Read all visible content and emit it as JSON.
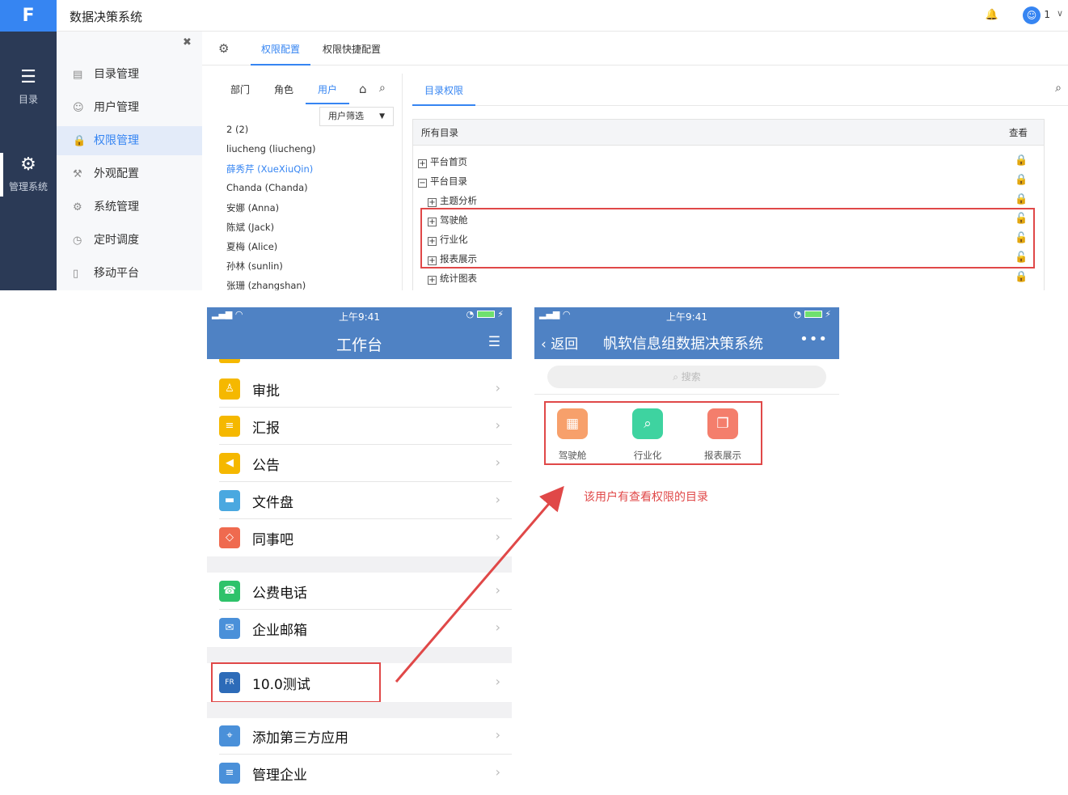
{
  "desktop": {
    "app_title": "数据决策系统",
    "user": {
      "name": "1"
    },
    "left_nav": [
      {
        "label": "目录"
      },
      {
        "label": "管理系统"
      }
    ],
    "sidebar": [
      {
        "label": "目录管理"
      },
      {
        "label": "用户管理"
      },
      {
        "label": "权限管理"
      },
      {
        "label": "外观配置"
      },
      {
        "label": "系统管理"
      },
      {
        "label": "定时调度"
      },
      {
        "label": "移动平台"
      }
    ],
    "tabs": [
      {
        "label": "权限配置"
      },
      {
        "label": "权限快捷配置"
      }
    ],
    "user_tabs": [
      {
        "label": "部门"
      },
      {
        "label": "角色"
      },
      {
        "label": "用户"
      }
    ],
    "filter_label": "用户筛选",
    "users": [
      "2 (2)",
      "liucheng (liucheng)",
      "薛秀芹 (XueXiuQin)",
      "Chanda (Chanda)",
      "安娜 (Anna)",
      "陈斌 (Jack)",
      "夏梅 (Alice)",
      "孙林 (sunlin)",
      "张珊 (zhangshan)"
    ],
    "right_tab": "目录权限",
    "tree_header": {
      "all": "所有目录",
      "view": "查看"
    },
    "tree": [
      {
        "label": "平台首页",
        "sign": "+",
        "lock": "locked"
      },
      {
        "label": "平台目录",
        "sign": "−",
        "lock": "locked"
      },
      {
        "label": "主题分析",
        "sign": "+",
        "lock": "locked"
      },
      {
        "label": "驾驶舱",
        "sign": "+",
        "lock": "unlocked"
      },
      {
        "label": "行业化",
        "sign": "+",
        "lock": "unlocked"
      },
      {
        "label": "报表展示",
        "sign": "+",
        "lock": "unlocked"
      },
      {
        "label": "统计图表",
        "sign": "+",
        "lock": "locked"
      }
    ]
  },
  "phone_left": {
    "time": "上午9:41",
    "title": "工作台",
    "group1": [
      {
        "label": "审批",
        "color": "#f5b800",
        "icon": "stamp-icon"
      },
      {
        "label": "汇报",
        "color": "#f5b800",
        "icon": "report-icon"
      },
      {
        "label": "公告",
        "color": "#f5b800",
        "icon": "megaphone-icon"
      },
      {
        "label": "文件盘",
        "color": "#4aa8e0",
        "icon": "disk-icon"
      },
      {
        "label": "同事吧",
        "color": "#ef6a4f",
        "icon": "colleague-icon"
      }
    ],
    "group2": [
      {
        "label": "公费电话",
        "color": "#2ec26a",
        "icon": "phone-icon"
      },
      {
        "label": "企业邮箱",
        "color": "#4a90d9",
        "icon": "mail-icon"
      }
    ],
    "group3": [
      {
        "label": "10.0测试",
        "color": "#2d6bb8",
        "icon": "fanruan-logo-icon"
      }
    ],
    "group4": [
      {
        "label": "添加第三方应用",
        "color": "#4a90d9",
        "icon": "compass-icon"
      },
      {
        "label": "管理企业",
        "color": "#4a90d9",
        "icon": "settings-sliders-icon"
      }
    ]
  },
  "phone_right": {
    "time": "上午9:41",
    "back": "返回",
    "title": "帆软信息组数据决策系统",
    "search_placeholder": "搜索",
    "apps": [
      {
        "label": "驾驶舱",
        "color": "#f7a06b"
      },
      {
        "label": "行业化",
        "color": "#3ed3a0"
      },
      {
        "label": "报表展示",
        "color": "#f47e6c"
      }
    ]
  },
  "annotation": "该用户有查看权限的目录",
  "colors": {
    "accent": "#3685f2",
    "nav_dark": "#2b3a56",
    "mobile_header": "#4f82c4",
    "highlight": "#e04848"
  }
}
